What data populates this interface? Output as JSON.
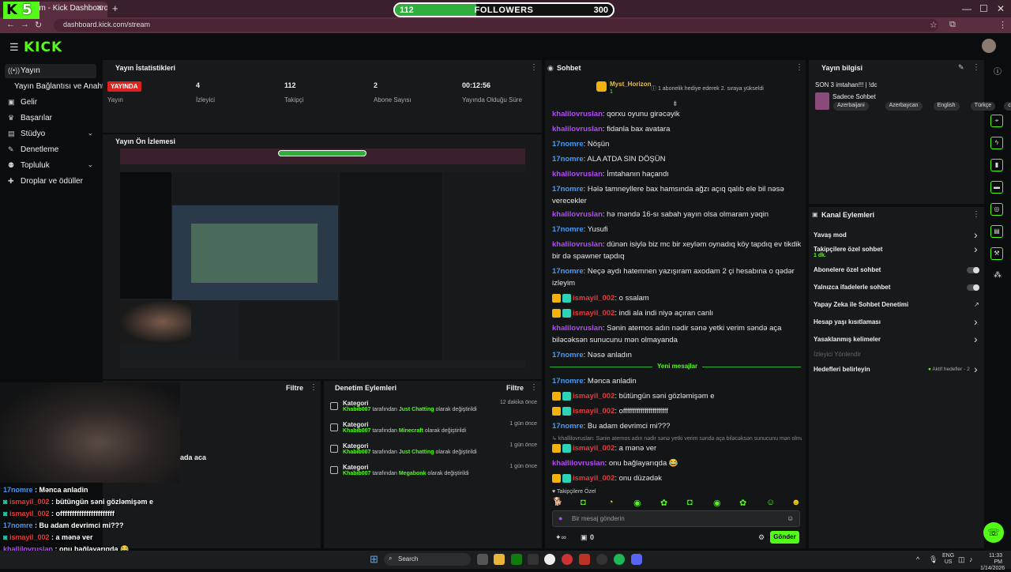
{
  "browser": {
    "tab_title": "am - Kick Dashboard",
    "url": "dashboard.kick.com/stream"
  },
  "overlay": {
    "logo_text": "K",
    "logo_number": "5",
    "follower_goal": {
      "current": "112",
      "label": "FOLLOWERS",
      "target": "300",
      "progress": 0.373
    }
  },
  "header": {
    "logo": "KICK"
  },
  "sidebar": {
    "items": [
      {
        "label": "Yayın",
        "icon": "broadcast-icon",
        "active": true
      },
      {
        "label": "Yayın Bağlantısı ve Anahtarı",
        "icon": "",
        "active": false
      },
      {
        "label": "Gelir",
        "icon": "money-icon",
        "active": false
      },
      {
        "label": "Başarılar",
        "icon": "trophy-icon",
        "active": false
      },
      {
        "label": "Stüdyo",
        "icon": "studio-icon",
        "active": false,
        "chevron": true
      },
      {
        "label": "Denetleme",
        "icon": "wrench-icon",
        "active": false
      },
      {
        "label": "Topluluk",
        "icon": "community-icon",
        "active": false,
        "chevron": true
      },
      {
        "label": "Droplar ve ödüller",
        "icon": "gift-icon",
        "active": false
      }
    ]
  },
  "stats": {
    "title": "Yayın İstatistikleri",
    "live_badge": "YAYINDA",
    "live_label": "Yayın",
    "viewers": {
      "value": "4",
      "label": "İzleyici"
    },
    "followers": {
      "value": "112",
      "label": "Takipçi"
    },
    "subs": {
      "value": "2",
      "label": "Abone Sayısı"
    },
    "uptime": {
      "value": "00:12:56",
      "label": "Yayında Olduğu Süre"
    }
  },
  "preview": {
    "title": "Yayın Ön İzlemesi"
  },
  "bottom_left": {
    "filter": "Filtre",
    "partial_text": "ada aca"
  },
  "mod_actions": {
    "title": "Denetim Eylemleri",
    "filter": "Filtre",
    "items": [
      {
        "title": "Kategori",
        "user": "Khabib007",
        "mid": "tarafından",
        "cat": "Just Chatting",
        "tail": "olarak değiştirildi",
        "time": "12 dakika önce"
      },
      {
        "title": "Kategori",
        "user": "Khabib007",
        "mid": "tarafından",
        "cat": "Minecraft",
        "tail": "olarak değiştirildi",
        "time": "1 gün önce"
      },
      {
        "title": "Kategori",
        "user": "Khabib007",
        "mid": "tarafından",
        "cat": "Just Chatting",
        "tail": "olarak değiştirildi",
        "time": "1 gün önce"
      },
      {
        "title": "Kategori",
        "user": "Khabib007",
        "mid": "tarafından",
        "cat": "Megabonk",
        "tail": "olarak değiştirildi",
        "time": "1 gün önce"
      }
    ]
  },
  "chat": {
    "title": "Sohbet",
    "pinned_user": "Myst_Horizon",
    "pinned_count": "1",
    "pinned_msg": "1 abonelik hediye ederek 2. sıraya yükseldi",
    "messages": [
      {
        "user": "khalilovruslan",
        "color": "purple",
        "text": "qorxu oyunu girəcəyik"
      },
      {
        "user": "khalilovruslan",
        "color": "purple",
        "text": "fidanla bax avatara"
      },
      {
        "user": "17nomre",
        "color": "blue",
        "text": "Nöşün"
      },
      {
        "user": "17nomre",
        "color": "blue",
        "text": "ALA ATDA SIN DÖŞÜN"
      },
      {
        "user": "khalilovruslan",
        "color": "purple",
        "text": "İmtahanın haçandı"
      },
      {
        "user": "17nomre",
        "color": "blue",
        "text": "Hələ tamneyllere bax hamsında ağzı açıq qalıb ele bil nəsə verecekler"
      },
      {
        "user": "khalilovruslan",
        "color": "purple",
        "text": "hə məndə 16-sı sabah yayın olsa olmaram yəqin"
      },
      {
        "user": "17nomre",
        "color": "blue",
        "text": "Yusufi"
      },
      {
        "user": "khalilovruslan",
        "color": "purple",
        "text": "dünən isiylə biz mc bir xeyləm oynadıq köy tapdıq ev tikdik bir də spawner tapdıq"
      },
      {
        "user": "17nomre",
        "color": "blue",
        "text": "Neçə aydı hatemnen yazışıram axodam 2 çi hesabına o qədər izleyim"
      },
      {
        "user": "ismayil_002",
        "color": "red",
        "badges": true,
        "text": "o ssalam"
      },
      {
        "user": "ismayil_002",
        "color": "red",
        "badges": true,
        "text": "indi ala indi niyə açıran canlı"
      },
      {
        "user": "khalilovruslan",
        "color": "purple",
        "text": "Sənin aternos adın nədir sənə yetki verim səndə aça biləcəksən sunucunu mən olmayanda"
      },
      {
        "user": "17nomre",
        "color": "blue",
        "text": "Nəsə anladın"
      }
    ],
    "new_messages_label": "Yeni mesajlar",
    "messages_after": [
      {
        "user": "17nomre",
        "color": "blue",
        "text": "Mənca anladin"
      },
      {
        "user": "ismayil_002",
        "color": "red",
        "badges": true,
        "text": "bütüngün səni gözləmişəm e"
      },
      {
        "user": "ismayil_002",
        "color": "red",
        "badges": true,
        "text": "offfffffffffffffffffffff"
      },
      {
        "user": "17nomre",
        "color": "blue",
        "text": "Bu adam devrimci mi???"
      },
      {
        "reply": "khallilovruslan: Sənin aternos adın nədir sənə yetki verim səndə aça biləcəksən sunucunu mən olmayan..."
      },
      {
        "user": "ismayil_002",
        "color": "red",
        "badges": true,
        "text": "a mənə ver"
      },
      {
        "user": "khallilovruslan",
        "color": "purple",
        "text": "onu bağlayarıqda 😂"
      },
      {
        "user": "ismayil_002",
        "color": "red",
        "badges": true,
        "text": "onu düzədək"
      }
    ],
    "followers_only": "Takipçilere Özel",
    "input_placeholder": "Bir mesaj gönderin",
    "send_label": "Gönder",
    "points": "0"
  },
  "stream_info": {
    "title": "Yayın bilgisi",
    "stream_title": "SON 3 imtahan!!! | !dc",
    "category": "Sadece Sohbet",
    "tags": [
      "Azerbaijani",
      "Azerbaycan",
      "English",
      "Türkçe",
      "chill"
    ]
  },
  "channel_actions": {
    "title": "Kanal Eylemleri",
    "items": [
      {
        "label": "Yavaş mod",
        "type": "arrow"
      },
      {
        "label": "Takipçilere özel sohbet",
        "sub": "1 dk.",
        "type": "arrow"
      },
      {
        "label": "Abonelere özel sohbet",
        "type": "toggle"
      },
      {
        "label": "Yalnızca ifadelerle sohbet",
        "type": "toggle"
      },
      {
        "label": "Yapay Zeka ile Sohbet Denetimi",
        "type": "link"
      },
      {
        "label": "Hesap yaşı kısıtlaması",
        "type": "arrow"
      },
      {
        "label": "Yasaklanmış kelimeler",
        "type": "arrow"
      },
      {
        "label": "İzleyici Yönlendir",
        "type": "disabled"
      },
      {
        "label": "Hedefleri belirleyin",
        "status": "Aktif hedefler - 2",
        "type": "arrow"
      }
    ]
  },
  "overlay_chat": [
    {
      "user": "17nomre",
      "color": "blue",
      "text": "Mənca anladin"
    },
    {
      "user": "ismayil_002",
      "color": "red",
      "text": "bütüngün səni gözləmişəm e"
    },
    {
      "user": "ismayil_002",
      "color": "red",
      "text": "offfffffffffffffffffffff"
    },
    {
      "user": "17nomre",
      "color": "blue",
      "text": "Bu adam devrimci mi???"
    },
    {
      "user": "ismayil_002",
      "color": "red",
      "text": "a mənə ver"
    },
    {
      "user": "khallilovruslan",
      "color": "purple",
      "text": "onu bağlayarıqda 😂"
    },
    {
      "user": "ismayil_002",
      "color": "red",
      "text": "onu düzədək"
    }
  ],
  "taskbar": {
    "search": "Search",
    "lang": "ENG",
    "region": "US",
    "time": "11:33 PM",
    "date": "1/14/2026"
  },
  "colors": {
    "accent": "#53fc18",
    "live": "#e0201b",
    "purple": "#b14cf2",
    "blue": "#4a9af0",
    "red": "#e53b3b"
  }
}
